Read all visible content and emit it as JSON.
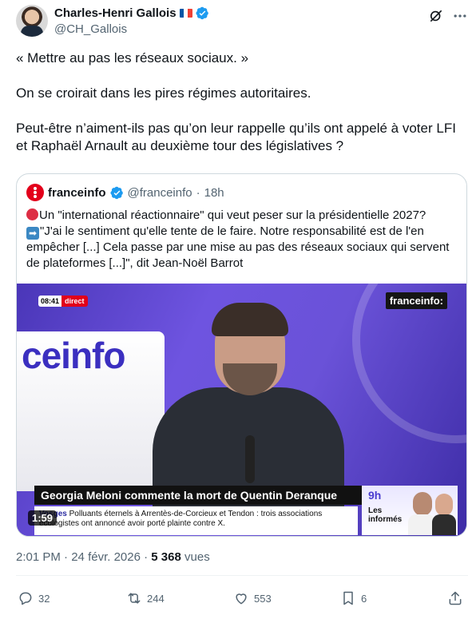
{
  "author": {
    "display_name": "Charles-Henri Gallois",
    "handle": "@CH_Gallois",
    "flag_colors": [
      "#0055a4",
      "#ffffff",
      "#ef4135"
    ]
  },
  "tweet": {
    "paragraphs": [
      "« Mettre au pas les réseaux sociaux. »",
      "On se croirait dans les pires régimes autoritaires.",
      "Peut-être n’aiment-ils pas qu’on leur rappelle qu’ils ont appelé à voter LFI et Raphaël Arnault au deuxième tour des législatives ?"
    ],
    "time": "2:01 PM",
    "date": "24 févr. 2026",
    "views_count": "5 368",
    "views_label": "vues"
  },
  "quote": {
    "name": "franceinfo",
    "handle": "@franceinfo",
    "dot": "·",
    "age": "18h",
    "lines": [
      "Un \"international réactionnaire\" qui veut peser sur la présidentielle 2027?",
      "\"J'ai le sentiment qu'elle tente de le faire. Notre responsabilité est de l'en",
      "empêcher [...] Cela passe par une mise au pas des réseaux sociaux qui servent",
      "de plateformes [...]\", dit Jean-Noël Barrot"
    ],
    "arrow_glyph": "➡",
    "brand_color": "#e3001b"
  },
  "video": {
    "live_time": "08:41",
    "live_label": "direct",
    "brand": "franceinfo:",
    "background_word": "ceinfo",
    "headline": "Georgia Meloni commente la mort de Quentin Deranque",
    "ticker_label": "Vosges",
    "ticker_text": "Polluants éternels à Arrentès-de-Corcieux et Tendon : trois associations écologistes ont annoncé avoir porté plainte contre X.",
    "promo_time": "9h",
    "promo_title_1": "Les",
    "promo_title_2": "informés",
    "duration": "1:59"
  },
  "actions": {
    "replies": "32",
    "reposts": "244",
    "likes": "553",
    "bookmarks": "6"
  },
  "icons": [
    "verified-badge-icon",
    "grok-icon",
    "more-icon",
    "reply-icon",
    "repost-icon",
    "like-icon",
    "bookmark-icon",
    "share-icon"
  ],
  "colors": {
    "verified": "#1d9bf0",
    "secondary_text": "#536471",
    "border": "#cfd9de"
  }
}
